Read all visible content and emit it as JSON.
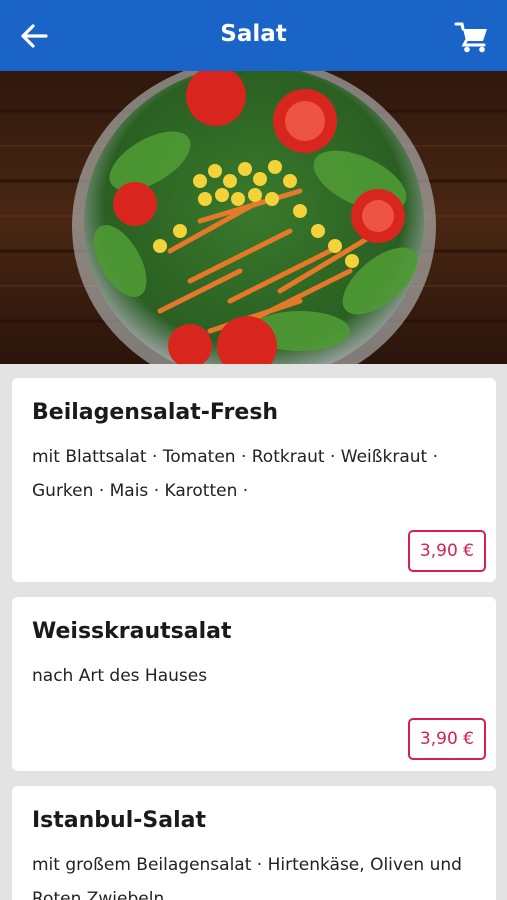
{
  "header": {
    "title": "Salat",
    "back_icon": "arrow-left-icon",
    "cart_icon": "shopping-cart-icon"
  },
  "hero": {
    "image": "salad-bowl-photo"
  },
  "items": [
    {
      "name": "Beilagensalat-Fresh",
      "description": "mit Blattsalat · Tomaten · Rotkraut · Weißkraut · Gurken · Mais · Karotten ·",
      "price": "3,90 €"
    },
    {
      "name": "Weisskrautsalat",
      "description": "nach Art des Hauses",
      "price": "3,90 €"
    },
    {
      "name": "Istanbul-Salat",
      "description": "mit großem Beilagensalat · Hirtenkäse, Oliven und Roten Zwiebeln"
    }
  ],
  "colors": {
    "appbar": "#1a64c7",
    "price_accent": "#d8204d",
    "background": "#e3e3e3"
  }
}
